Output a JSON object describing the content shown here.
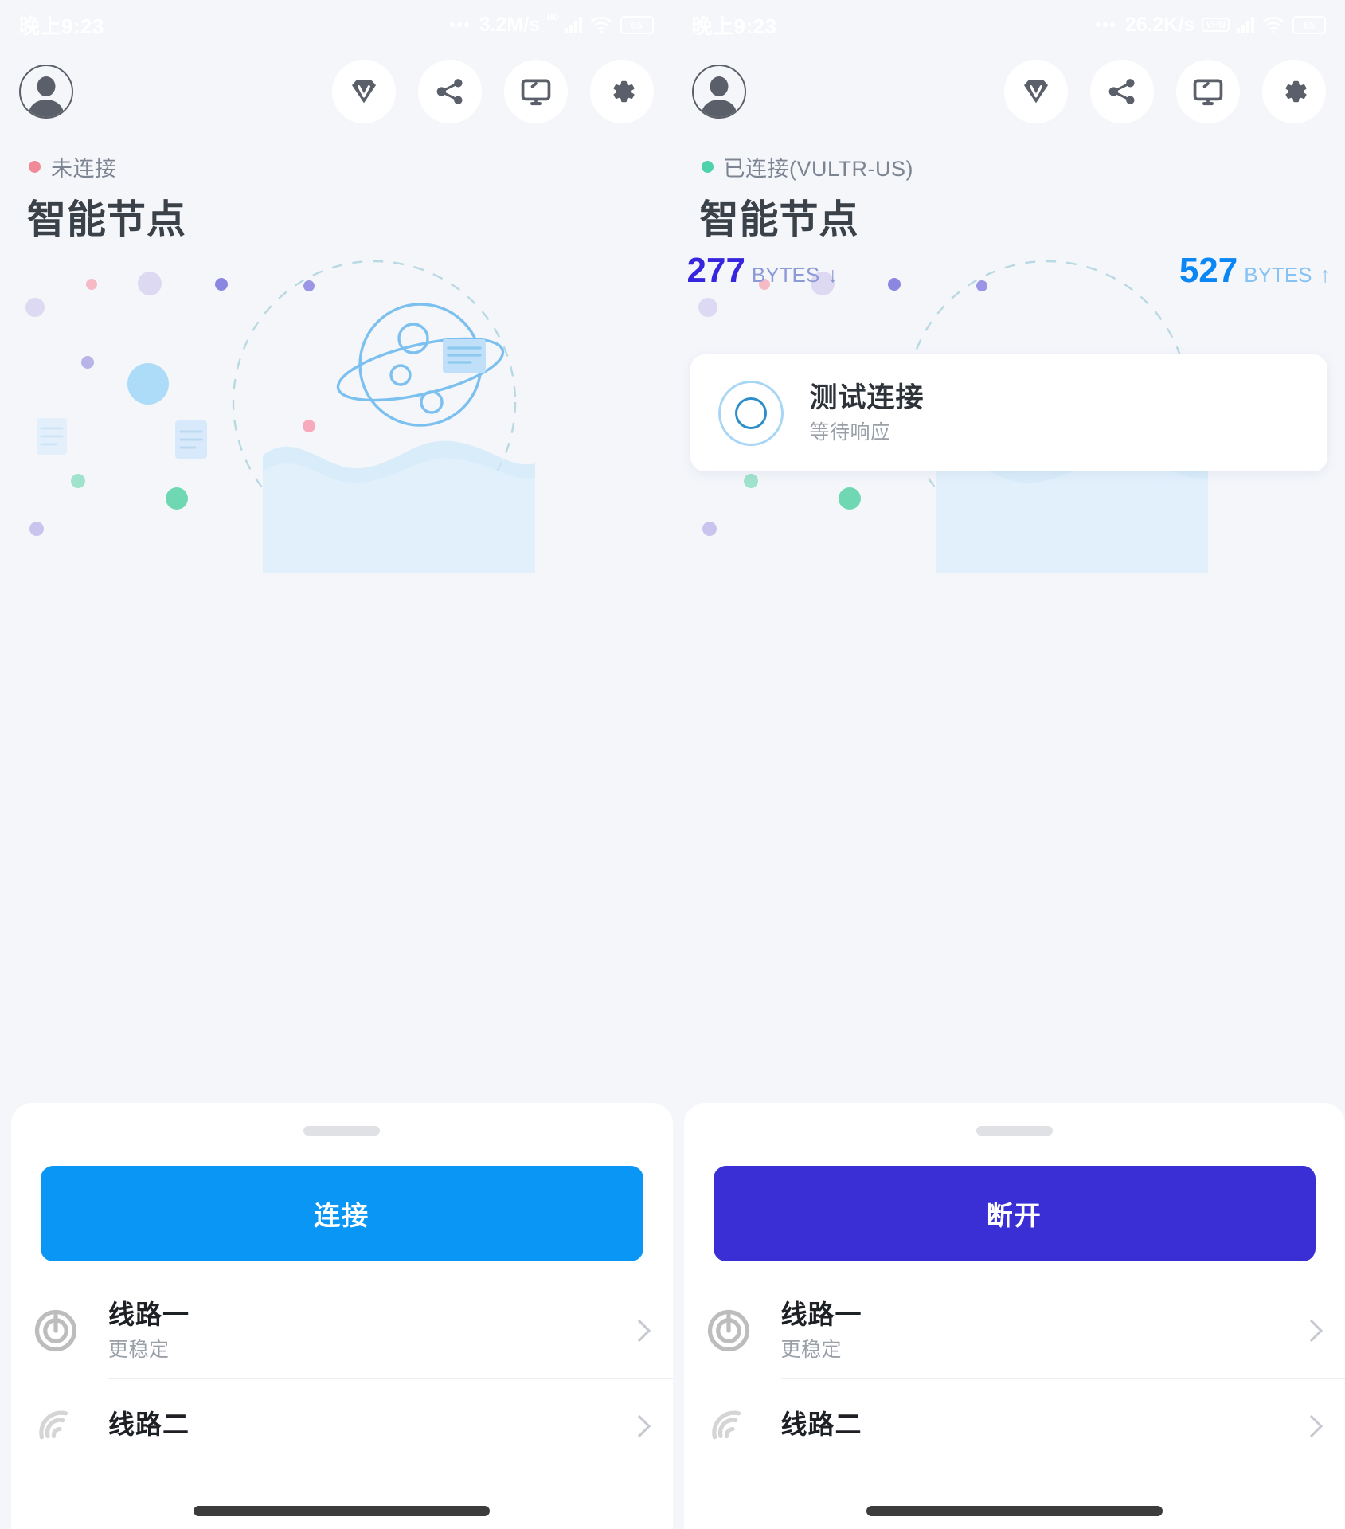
{
  "app": {
    "title": "智能节点",
    "colors": {
      "background": "#f4f6fa",
      "connect_button": "#0a96f5",
      "disconnect_button": "#3a2fd4",
      "download_accent": "#3826df",
      "upload_accent": "#0a86f5",
      "disconnected_dot": "#f08a98",
      "connected_dot": "#4fd1ac"
    }
  },
  "left": {
    "statusbar": {
      "time": "晚上9:23",
      "speed": "3.2M/s",
      "hd_label": "HD",
      "battery": "65",
      "icons": [
        "signal-bars-icon",
        "wifi-icon",
        "battery-icon"
      ]
    },
    "topbar": {
      "avatar_icon": "avatar-icon",
      "buttons": [
        {
          "icon": "diamond-vip-icon",
          "name": "vip-button"
        },
        {
          "icon": "share-nodes-icon",
          "name": "share-button"
        },
        {
          "icon": "monitor-icon",
          "name": "monitor-button"
        },
        {
          "icon": "gear-icon",
          "name": "settings-button"
        }
      ]
    },
    "connection": {
      "status_text": "未连接",
      "status_dot_color": "#f08a98",
      "title": "智能节点"
    },
    "sheet": {
      "action_label": "连接",
      "action_style": "connect",
      "routes": [
        {
          "title": "线路一",
          "subtitle": "更稳定",
          "icon": "radar-power-icon"
        },
        {
          "title": "线路二",
          "subtitle": "",
          "icon": "radar-signal-icon"
        }
      ]
    }
  },
  "right": {
    "statusbar": {
      "time": "晚上9:23",
      "speed": "26.2K/s",
      "vpn_label": "VPN",
      "battery": "65",
      "icons": [
        "vpn-badge-icon",
        "signal-bars-icon",
        "wifi-icon",
        "battery-icon"
      ]
    },
    "topbar": {
      "avatar_icon": "avatar-icon",
      "buttons": [
        {
          "icon": "diamond-vip-icon",
          "name": "vip-button"
        },
        {
          "icon": "share-nodes-icon",
          "name": "share-button"
        },
        {
          "icon": "monitor-icon",
          "name": "monitor-button"
        },
        {
          "icon": "gear-icon",
          "name": "settings-button"
        }
      ]
    },
    "connection": {
      "status_text": "已连接(VULTR-US)",
      "status_dot_color": "#4fd1ac",
      "title": "智能节点"
    },
    "traffic": {
      "download_value": "277",
      "download_unit": "BYTES",
      "download_arrow": "↓",
      "upload_value": "527",
      "upload_unit": "BYTES",
      "upload_arrow": "↑"
    },
    "test_card": {
      "title": "测试连接",
      "subtitle": "等待响应"
    },
    "sheet": {
      "action_label": "断开",
      "action_style": "disconnect",
      "routes": [
        {
          "title": "线路一",
          "subtitle": "更稳定",
          "icon": "radar-power-icon"
        },
        {
          "title": "线路二",
          "subtitle": "",
          "icon": "radar-signal-icon"
        }
      ]
    }
  }
}
